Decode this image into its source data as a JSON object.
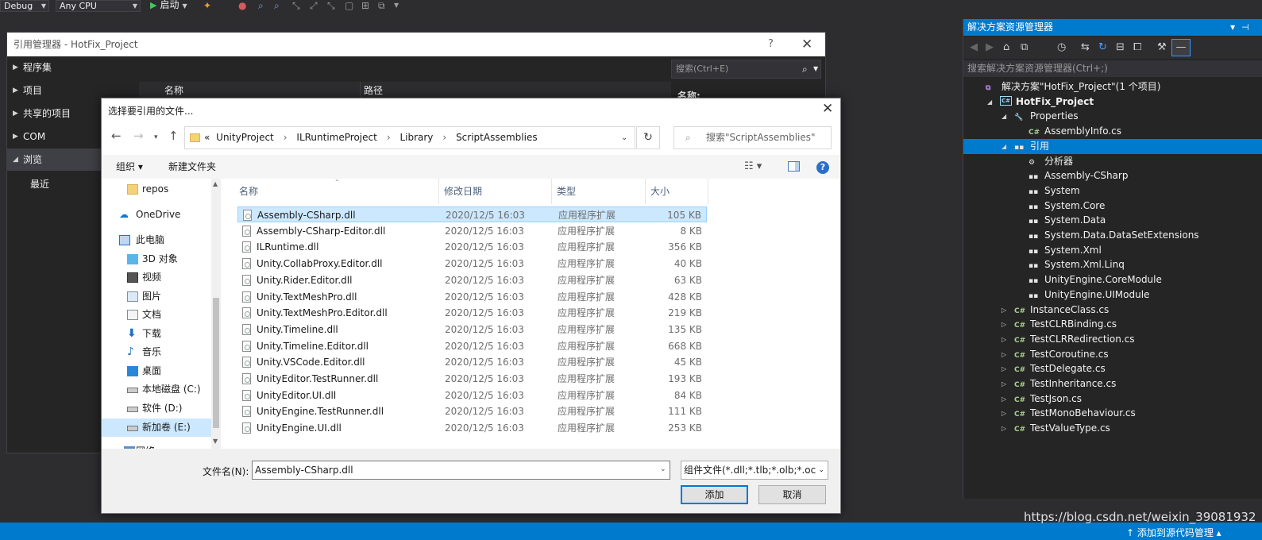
{
  "toolbar": {
    "config": "Debug",
    "platform": "Any CPU",
    "start": "启动"
  },
  "ref_manager": {
    "title": "引用管理器 - HotFix_Project",
    "help": "?",
    "close": "✕",
    "nav": [
      "程序集",
      "项目",
      "共享的项目",
      "COM",
      "浏览",
      "最近"
    ],
    "columns": [
      "名称",
      "路径"
    ],
    "search_placeholder": "搜索(Ctrl+E)",
    "right_label": "名称:"
  },
  "file_dialog": {
    "title": "选择要引用的文件...",
    "close": "✕",
    "breadcrumb": [
      "UnityProject",
      "ILRuntimeProject",
      "Library",
      "ScriptAssemblies"
    ],
    "breadcrumb_prefix": "«",
    "search_placeholder": "搜索\"ScriptAssemblies\"",
    "organize": "组织 ▾",
    "new_folder": "新建文件夹",
    "tree": [
      {
        "label": "repos",
        "icon": "folder-icon"
      },
      {
        "label": "OneDrive",
        "icon": "cloud-icon"
      },
      {
        "label": "此电脑",
        "icon": "computer-icon"
      },
      {
        "label": "3D 对象",
        "icon": "3d-objects-icon"
      },
      {
        "label": "视频",
        "icon": "video-icon"
      },
      {
        "label": "图片",
        "icon": "pictures-icon"
      },
      {
        "label": "文档",
        "icon": "documents-icon"
      },
      {
        "label": "下载",
        "icon": "download-icon"
      },
      {
        "label": "音乐",
        "icon": "music-icon"
      },
      {
        "label": "桌面",
        "icon": "desktop-icon"
      },
      {
        "label": "本地磁盘 (C:)",
        "icon": "drive-icon"
      },
      {
        "label": "软件 (D:)",
        "icon": "drive-icon"
      },
      {
        "label": "新加卷 (E:)",
        "icon": "drive-icon"
      },
      {
        "label": "网络",
        "icon": "network-icon"
      }
    ],
    "columns": {
      "name": "名称",
      "date": "修改日期",
      "type": "类型",
      "size": "大小"
    },
    "files": [
      {
        "name": "Assembly-CSharp.dll",
        "date": "2020/12/5 16:03",
        "type": "应用程序扩展",
        "size": "105 KB"
      },
      {
        "name": "Assembly-CSharp-Editor.dll",
        "date": "2020/12/5 16:03",
        "type": "应用程序扩展",
        "size": "8 KB"
      },
      {
        "name": "ILRuntime.dll",
        "date": "2020/12/5 16:03",
        "type": "应用程序扩展",
        "size": "356 KB"
      },
      {
        "name": "Unity.CollabProxy.Editor.dll",
        "date": "2020/12/5 16:03",
        "type": "应用程序扩展",
        "size": "40 KB"
      },
      {
        "name": "Unity.Rider.Editor.dll",
        "date": "2020/12/5 16:03",
        "type": "应用程序扩展",
        "size": "63 KB"
      },
      {
        "name": "Unity.TextMeshPro.dll",
        "date": "2020/12/5 16:03",
        "type": "应用程序扩展",
        "size": "428 KB"
      },
      {
        "name": "Unity.TextMeshPro.Editor.dll",
        "date": "2020/12/5 16:03",
        "type": "应用程序扩展",
        "size": "219 KB"
      },
      {
        "name": "Unity.Timeline.dll",
        "date": "2020/12/5 16:03",
        "type": "应用程序扩展",
        "size": "135 KB"
      },
      {
        "name": "Unity.Timeline.Editor.dll",
        "date": "2020/12/5 16:03",
        "type": "应用程序扩展",
        "size": "668 KB"
      },
      {
        "name": "Unity.VSCode.Editor.dll",
        "date": "2020/12/5 16:03",
        "type": "应用程序扩展",
        "size": "45 KB"
      },
      {
        "name": "UnityEditor.TestRunner.dll",
        "date": "2020/12/5 16:03",
        "type": "应用程序扩展",
        "size": "193 KB"
      },
      {
        "name": "UnityEditor.UI.dll",
        "date": "2020/12/5 16:03",
        "type": "应用程序扩展",
        "size": "84 KB"
      },
      {
        "name": "UnityEngine.TestRunner.dll",
        "date": "2020/12/5 16:03",
        "type": "应用程序扩展",
        "size": "111 KB"
      },
      {
        "name": "UnityEngine.UI.dll",
        "date": "2020/12/5 16:03",
        "type": "应用程序扩展",
        "size": "253 KB"
      }
    ],
    "filename_label": "文件名(N):",
    "filename_value": "Assembly-CSharp.dll",
    "filter": "组件文件(*.dll;*.tlb;*.olb;*.ocx;",
    "add": "添加",
    "cancel": "取消"
  },
  "solution_explorer": {
    "title": "解决方案资源管理器",
    "search_placeholder": "搜索解决方案资源管理器(Ctrl+;)",
    "nodes": [
      {
        "label": "解决方案\"HotFix_Project\"(1 个项目)",
        "icon": "solution-icon",
        "indent": 0,
        "expander": ""
      },
      {
        "label": "HotFix_Project",
        "icon": "csharp-project-icon",
        "indent": 1,
        "expander": "◢",
        "bold": true
      },
      {
        "label": "Properties",
        "icon": "wrench-icon",
        "indent": 2,
        "expander": "◢"
      },
      {
        "label": "AssemblyInfo.cs",
        "icon": "csharp-file-icon",
        "indent": 3,
        "expander": ""
      },
      {
        "label": "引用",
        "icon": "references-icon",
        "indent": 2,
        "expander": "◢",
        "selected": true
      },
      {
        "label": "分析器",
        "icon": "analyzer-icon",
        "indent": 3,
        "expander": ""
      },
      {
        "label": "Assembly-CSharp",
        "icon": "reference-icon",
        "indent": 3,
        "expander": ""
      },
      {
        "label": "System",
        "icon": "reference-icon",
        "indent": 3,
        "expander": ""
      },
      {
        "label": "System.Core",
        "icon": "reference-icon",
        "indent": 3,
        "expander": ""
      },
      {
        "label": "System.Data",
        "icon": "reference-icon",
        "indent": 3,
        "expander": ""
      },
      {
        "label": "System.Data.DataSetExtensions",
        "icon": "reference-icon",
        "indent": 3,
        "expander": ""
      },
      {
        "label": "System.Xml",
        "icon": "reference-icon",
        "indent": 3,
        "expander": ""
      },
      {
        "label": "System.Xml.Linq",
        "icon": "reference-icon",
        "indent": 3,
        "expander": ""
      },
      {
        "label": "UnityEngine.CoreModule",
        "icon": "reference-icon",
        "indent": 3,
        "expander": ""
      },
      {
        "label": "UnityEngine.UIModule",
        "icon": "reference-icon",
        "indent": 3,
        "expander": ""
      },
      {
        "label": "InstanceClass.cs",
        "icon": "csharp-file-icon",
        "indent": 2,
        "expander": "▷"
      },
      {
        "label": "TestCLRBinding.cs",
        "icon": "csharp-file-icon",
        "indent": 2,
        "expander": "▷"
      },
      {
        "label": "TestCLRRedirection.cs",
        "icon": "csharp-file-icon",
        "indent": 2,
        "expander": "▷"
      },
      {
        "label": "TestCoroutine.cs",
        "icon": "csharp-file-icon",
        "indent": 2,
        "expander": "▷"
      },
      {
        "label": "TestDelegate.cs",
        "icon": "csharp-file-icon",
        "indent": 2,
        "expander": "▷"
      },
      {
        "label": "TestInheritance.cs",
        "icon": "csharp-file-icon",
        "indent": 2,
        "expander": "▷"
      },
      {
        "label": "TestJson.cs",
        "icon": "csharp-file-icon",
        "indent": 2,
        "expander": "▷"
      },
      {
        "label": "TestMonoBehaviour.cs",
        "icon": "csharp-file-icon",
        "indent": 2,
        "expander": "▷"
      },
      {
        "label": "TestValueType.cs",
        "icon": "csharp-file-icon",
        "indent": 2,
        "expander": "▷"
      }
    ]
  },
  "status_bar": {
    "right": "↑ 添加到源代码管理 ▴"
  },
  "watermark": "https://blog.csdn.net/weixin_39081932",
  "colors": {
    "accent": "#007acc",
    "vs_background": "#2d2d30",
    "selection": "#cce8ff"
  }
}
